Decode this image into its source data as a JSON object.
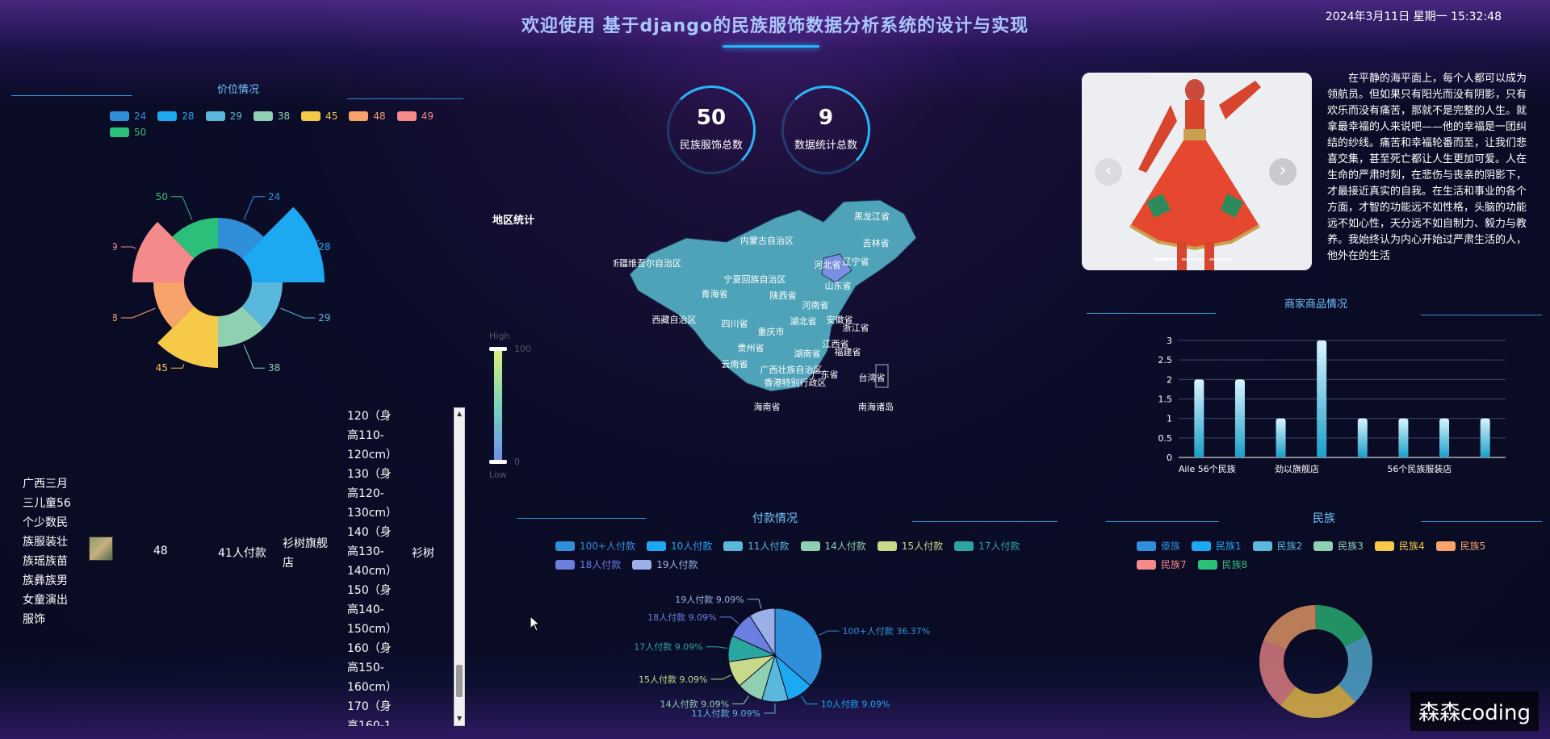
{
  "header": {
    "title": "欢迎使用 基于django的民族服饰数据分析系统的设计与实现",
    "datetime": "2024年3月11日 星期一 15:32:48"
  },
  "price_section": {
    "title": "价位情况",
    "legend": [
      {
        "label": "24",
        "color": "#2f8fd8"
      },
      {
        "label": "28",
        "color": "#1da8f2"
      },
      {
        "label": "29",
        "color": "#5ab8dd"
      },
      {
        "label": "38",
        "color": "#8fcfb2"
      },
      {
        "label": "45",
        "color": "#f7c948"
      },
      {
        "label": "48",
        "color": "#f7a36b"
      },
      {
        "label": "49",
        "color": "#f48a8a"
      },
      {
        "label": "50",
        "color": "#2bbf7a"
      }
    ]
  },
  "stats": [
    {
      "value": "50",
      "label": "民族服饰总数"
    },
    {
      "value": "9",
      "label": "数据统计总数"
    }
  ],
  "map_section": {
    "title": "地区统计",
    "scale_high": "High",
    "scale_low": "Low",
    "scale_max": "100",
    "scale_min": "0",
    "region_labels": [
      "黑龙江省",
      "内蒙古自治区",
      "吉林省",
      "新疆维吾尔自治区",
      "辽宁省",
      "河北省",
      "宁夏回族自治区",
      "山东省",
      "青海省",
      "陕西省",
      "河南省",
      "西藏自治区",
      "四川省",
      "湖北省",
      "安徽省",
      "浙江省",
      "重庆市",
      "江西省",
      "福建省",
      "贵州省",
      "湖南省",
      "广西壮族自治区",
      "广东省",
      "云南省",
      "台湾省",
      "香港特别行政区",
      "海南省",
      "南海诸岛"
    ]
  },
  "table": {
    "row": {
      "name": "广西三月三儿童56个少数民族服装壮族瑶族苗族彝族男女童演出服饰",
      "price": "48",
      "payers": "41人付款",
      "shop": "衫树旗舰店",
      "sizes": "120（身高110-120cm）130（身高120-130cm）140（身高130-140cm）150（身高140-150cm）160（身高150-160cm）170（身高160-1",
      "brand": "衫树"
    }
  },
  "carousel": {
    "prev_icon": "‹",
    "next_icon": "›"
  },
  "paragraph": {
    "text": "在平静的海平面上，每个人都可以成为领航员。但如果只有阳光而没有阴影，只有欢乐而没有痛苦，那就不是完整的人生。就拿最幸福的人来说吧——他的幸福是一团纠结的纱线。痛苦和幸福轮番而至，让我们悲喜交集，甚至死亡都让人生更加可爱。人在生命的严肃时刻，在悲伤与丧亲的阴影下，才最接近真实的自我。在生活和事业的各个方面，才智的功能远不如性格，头脑的功能远不如心性，天分远不如自制力、毅力与教养。我始终认为内心开始过严肃生活的人，他外在的生活"
  },
  "merchant_section": {
    "title": "商家商品情况",
    "x_labels": [
      "Aile 56个民族",
      "劲以旗舰店",
      "56个民族服装店"
    ],
    "y_ticks": [
      "0",
      "0.5",
      "1",
      "1.5",
      "2",
      "2.5",
      "3"
    ]
  },
  "payment_section": {
    "title": "付款情况",
    "legend": [
      {
        "label": "100+人付款",
        "color": "#2f8fd8"
      },
      {
        "label": "10人付款",
        "color": "#1da8f2"
      },
      {
        "label": "11人付款",
        "color": "#5ab8dd"
      },
      {
        "label": "14人付款",
        "color": "#8fcfb2"
      },
      {
        "label": "15人付款",
        "color": "#c8d98a"
      },
      {
        "label": "17人付款",
        "color": "#2aa5a0"
      },
      {
        "label": "18人付款",
        "color": "#6a7fe0"
      },
      {
        "label": "19人付款",
        "color": "#9bb0e6"
      }
    ],
    "slice_labels": [
      "100+人付款 36.37%",
      "10人付款 9.09%",
      "11人付款 9.09%",
      "14人付款 9.09%",
      "15人付款 9.09%",
      "17人付款 9.09%",
      "18人付款 9.09%",
      "19人付款 9.09%"
    ]
  },
  "ethnic_section": {
    "title": "民族",
    "legend": [
      {
        "label": "傣族",
        "color": "#2f8fd8"
      },
      {
        "label": "民族1",
        "color": "#1da8f2"
      },
      {
        "label": "民族2",
        "color": "#5ab8dd"
      },
      {
        "label": "民族3",
        "color": "#8fcfb2"
      },
      {
        "label": "民族4",
        "color": "#f7c948"
      },
      {
        "label": "民族5",
        "color": "#f7a36b"
      },
      {
        "label": "民族7",
        "color": "#f48a8a"
      },
      {
        "label": "民族8",
        "color": "#2bbf7a"
      }
    ]
  },
  "watermark": "森森coding",
  "chart_data": [
    {
      "type": "pie",
      "title": "价位情况",
      "variant": "rose",
      "categories": [
        "24",
        "28",
        "29",
        "38",
        "45",
        "48",
        "49",
        "50"
      ],
      "values": [
        1,
        3,
        1,
        1,
        2,
        1,
        2,
        1
      ]
    },
    {
      "type": "bar",
      "title": "商家商品情况",
      "categories": [
        "Aile 56个民族",
        "",
        "劲以旗舰店",
        "",
        "",
        "56个民族服装店",
        "",
        ""
      ],
      "values": [
        2,
        2,
        1,
        3,
        1,
        1,
        1,
        1
      ],
      "ylim": [
        0,
        3
      ]
    },
    {
      "type": "pie",
      "title": "付款情况",
      "categories": [
        "100+人付款",
        "10人付款",
        "11人付款",
        "14人付款",
        "15人付款",
        "17人付款",
        "18人付款",
        "19人付款"
      ],
      "values": [
        36.37,
        9.09,
        9.09,
        9.09,
        9.09,
        9.09,
        9.09,
        9.09
      ]
    }
  ]
}
